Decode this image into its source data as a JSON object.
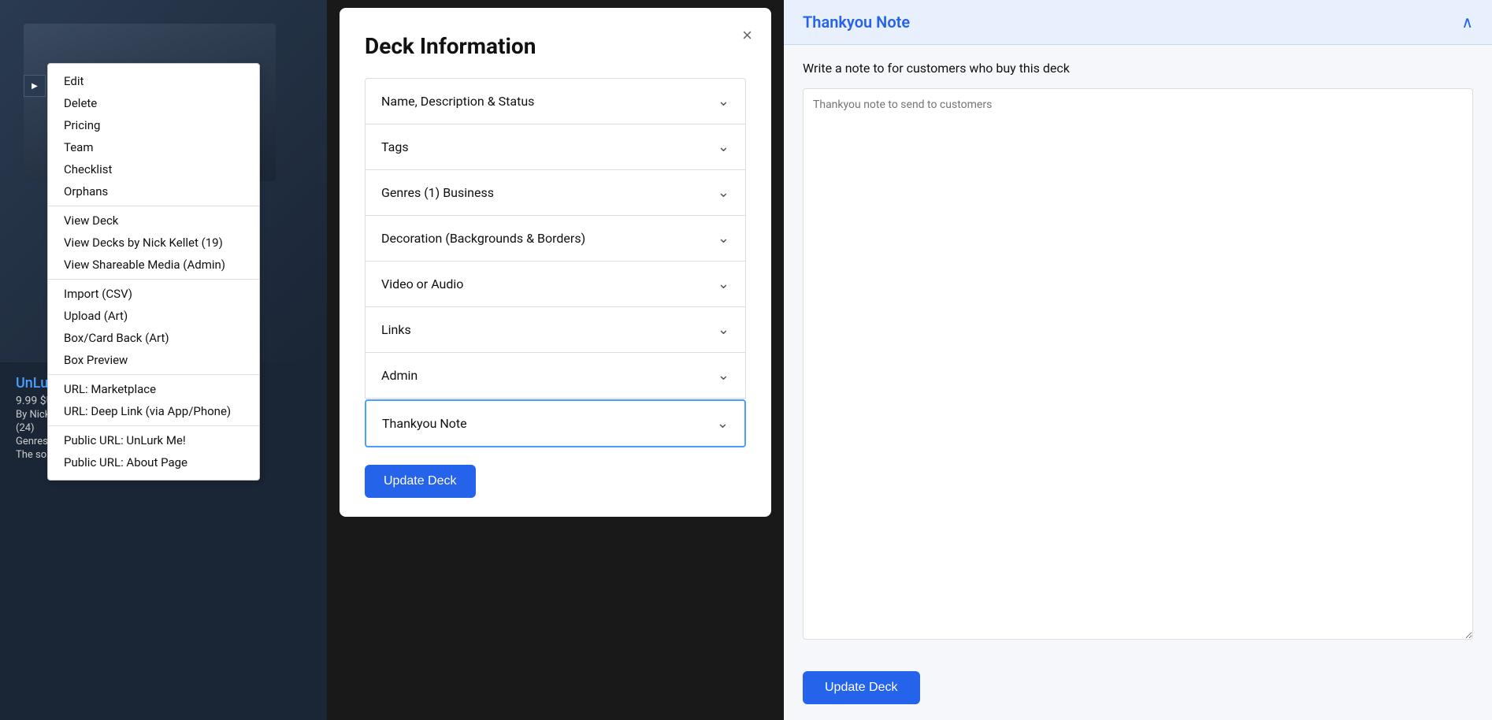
{
  "leftPanel": {
    "expandBtn": "▶",
    "deckNameLink": "UnLur...",
    "deckPrice": "9.99 $U...",
    "deckAuthor": "By Nick...",
    "deckCount": "(24)",
    "deckGenre": "Genres...",
    "deckDesc": "The so..."
  },
  "contextMenu": {
    "items": [
      {
        "label": "Edit",
        "group": 1
      },
      {
        "label": "Delete",
        "group": 1
      },
      {
        "label": "Pricing",
        "group": 1
      },
      {
        "label": "Team",
        "group": 1
      },
      {
        "label": "Checklist",
        "group": 1
      },
      {
        "label": "Orphans",
        "group": 1
      },
      {
        "label": "View Deck",
        "group": 2
      },
      {
        "label": "View Decks by Nick Kellet (19)",
        "group": 2
      },
      {
        "label": "View Shareable Media (Admin)",
        "group": 2
      },
      {
        "label": "Import (CSV)",
        "group": 3
      },
      {
        "label": "Upload (Art)",
        "group": 3
      },
      {
        "label": "Box/Card Back (Art)",
        "group": 3
      },
      {
        "label": "Box Preview",
        "group": 3
      },
      {
        "label": "URL: Marketplace",
        "group": 4
      },
      {
        "label": "URL: Deep Link (via App/Phone)",
        "group": 4
      },
      {
        "label": "Public URL: UnLurk Me!",
        "group": 5
      },
      {
        "label": "Public URL: About Page",
        "group": 5
      }
    ]
  },
  "modal": {
    "title": "Deck Information",
    "closeLabel": "×",
    "accordionItems": [
      {
        "label": "Name, Description & Status",
        "active": false
      },
      {
        "label": "Tags",
        "active": false
      },
      {
        "label": "Genres (1) Business",
        "active": false
      },
      {
        "label": "Decoration (Backgrounds & Borders)",
        "active": false
      },
      {
        "label": "Video or Audio",
        "active": false
      },
      {
        "label": "Links",
        "active": false
      },
      {
        "label": "Admin",
        "active": false
      },
      {
        "label": "Thankyou Note",
        "active": true
      }
    ],
    "updateBtn": "Update Deck"
  },
  "rightPanel": {
    "headerTitle": "Thankyou Note",
    "chevronUp": "∧",
    "description": "Write a note to for customers who buy this deck",
    "textareaPlaceholder": "Thankyou note to send to customers",
    "updateBtn": "Update Deck"
  }
}
